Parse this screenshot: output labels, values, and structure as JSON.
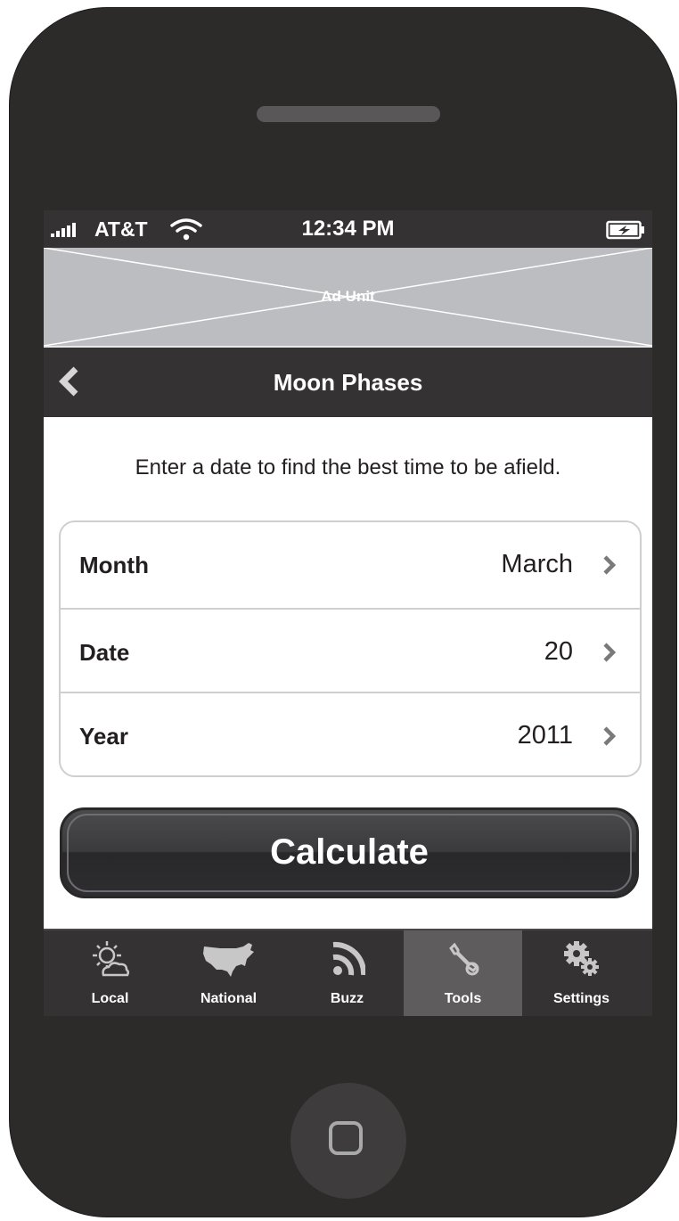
{
  "status_bar": {
    "carrier": "AT&T",
    "time": "12:34 PM"
  },
  "ad": {
    "label": "Ad Unit"
  },
  "nav": {
    "title": "Moon Phases"
  },
  "intro_text": "Enter a date to find the best time to be afield.",
  "fields": [
    {
      "label": "Month",
      "value": "March"
    },
    {
      "label": "Date",
      "value": "20"
    },
    {
      "label": "Year",
      "value": "2011"
    }
  ],
  "calculate_label": "Calculate",
  "tabs": [
    {
      "label": "Local",
      "icon": "sun-cloud-icon",
      "active": false
    },
    {
      "label": "National",
      "icon": "usa-map-icon",
      "active": false
    },
    {
      "label": "Buzz",
      "icon": "rss-icon",
      "active": false
    },
    {
      "label": "Tools",
      "icon": "wrench-icon",
      "active": true
    },
    {
      "label": "Settings",
      "icon": "gears-icon",
      "active": false
    }
  ],
  "colors": {
    "bar": "#353233",
    "active_tab": "#5e5c5d",
    "ad_placeholder": "#bcbdc0",
    "phone_body": "#2d2a2a"
  }
}
